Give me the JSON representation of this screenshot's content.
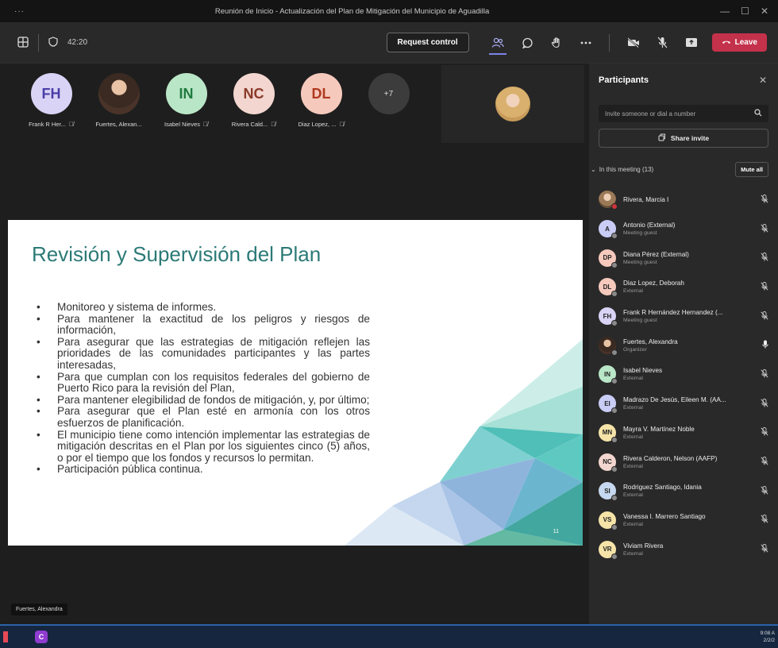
{
  "window": {
    "menu_dots": "···",
    "title": "Reunión de Inicio - Actualización del Plan de Mitigación del Municipio de Aguadilla",
    "minimize": "—",
    "maximize": "☐",
    "close": "✕"
  },
  "toolbar": {
    "timer": "42:20",
    "request_control": "Request control",
    "leave": "Leave"
  },
  "tiles": [
    {
      "initials": "FH",
      "name": "Frank R Her...",
      "bg": "#d9d3f5",
      "fg": "#4b3fa8"
    },
    {
      "initials": "",
      "name": "Fuertes, Alexan...",
      "photo": true
    },
    {
      "initials": "IN",
      "name": "Isabel Nieves",
      "bg": "#b9e6c7",
      "fg": "#1f7a3e"
    },
    {
      "initials": "NC",
      "name": "Rivera Cald...",
      "bg": "#f2d6cf",
      "fg": "#8a3a2a"
    },
    {
      "initials": "DL",
      "name": "Diaz Lopez, ...",
      "bg": "#f6c9bd",
      "fg": "#b0391f"
    }
  ],
  "more_count": "+7",
  "slide": {
    "title": "Revisión y Supervisión del Plan",
    "bullets": [
      "Monitoreo y sistema de informes.",
      "Para mantener la exactitud de los peligros y riesgos de información,",
      "Para asegurar que las estrategias de mitigación reflejen las prioridades de las comunidades participantes y las partes interesadas,",
      "Para que cumplan con los requisitos federales del gobierno de Puerto Rico para la revisión del Plan,",
      "Para mantener elegibilidad de fondos de mitigación, y, por último;",
      "Para asegurar que el Plan esté en armonía con los otros esfuerzos de planificación.",
      "El municipio tiene como intención implementar las estrategias de mitigación descritas en el Plan por los siguientes cinco (5) años, o por el tiempo que los fondos y recursos lo permitan.",
      "Participación pública continua."
    ],
    "page_number": "11"
  },
  "speaker_label": "Fuertes, Alexandra",
  "panel": {
    "title": "Participants",
    "invite_placeholder": "Invite someone or dial a number",
    "share_invite": "Share invite",
    "section": "In this meeting (13)",
    "mute_all": "Mute all",
    "participants": [
      {
        "initials": "",
        "name": "Rivera, Marcia I",
        "role": "",
        "photo": "a",
        "status": "red"
      },
      {
        "initials": "A",
        "name": "Antonio (External)",
        "role": "Meeting guest",
        "bg": "#c9cdf5"
      },
      {
        "initials": "DP",
        "name": "Diana Pérez (External)",
        "role": "Meeting guest",
        "bg": "#f6c9bd"
      },
      {
        "initials": "DL",
        "name": "Diaz Lopez, Deborah",
        "role": "External",
        "bg": "#f6c9bd"
      },
      {
        "initials": "FH",
        "name": "Frank R Hernández Hernandez (...",
        "role": "Meeting guest",
        "bg": "#d9d3f5"
      },
      {
        "initials": "",
        "name": "Fuertes, Alexandra",
        "role": "Organizer",
        "photo": "b",
        "mic_on": true
      },
      {
        "initials": "IN",
        "name": "Isabel Nieves",
        "role": "External",
        "bg": "#b9e6c7"
      },
      {
        "initials": "EI",
        "name": "Madrazo De Jesús, Eileen M. (AA...",
        "role": "External",
        "bg": "#c9cdf5"
      },
      {
        "initials": "MN",
        "name": "Mayra V. Martínez Noble",
        "role": "External",
        "bg": "#f5e3a8"
      },
      {
        "initials": "NC",
        "name": "Rivera Calderon, Nelson (AAFP)",
        "role": "External",
        "bg": "#f2d6cf"
      },
      {
        "initials": "SI",
        "name": "Rodriguez Santiago, Idania",
        "role": "External",
        "bg": "#c6d8ef"
      },
      {
        "initials": "VS",
        "name": "Vanessa I. Marrero Santiago",
        "role": "External",
        "bg": "#f5e3a8"
      },
      {
        "initials": "VR",
        "name": "Viviam Rivera",
        "role": "External",
        "bg": "#f5e3a8"
      }
    ]
  },
  "taskbar": {
    "time": "9:08 A",
    "date": "2/2/2"
  }
}
